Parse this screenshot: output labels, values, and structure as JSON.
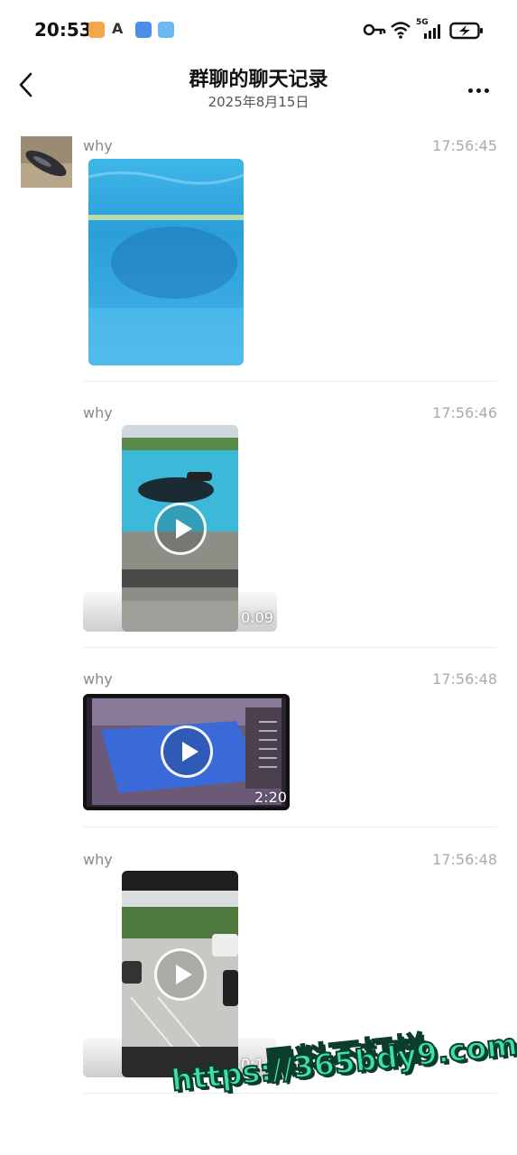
{
  "status_bar": {
    "time": "20:53",
    "network": "5G"
  },
  "header": {
    "title": "群聊的聊天记录",
    "date": "2025年8月15日"
  },
  "messages": [
    {
      "sender": "why",
      "time": "17:56:45",
      "type": "image"
    },
    {
      "sender": "why",
      "time": "17:56:46",
      "type": "video",
      "duration": "0:09"
    },
    {
      "sender": "why",
      "time": "17:56:48",
      "type": "video",
      "duration": "2:20"
    },
    {
      "sender": "why",
      "time": "17:56:48",
      "type": "video",
      "duration": "0:1"
    }
  ],
  "watermark": {
    "line1": "黑料不打烊",
    "line2": "https://365bdy9.com"
  },
  "colors": {
    "watermark_fill": "#3de0a8",
    "watermark_stroke": "#0a3d2c"
  }
}
